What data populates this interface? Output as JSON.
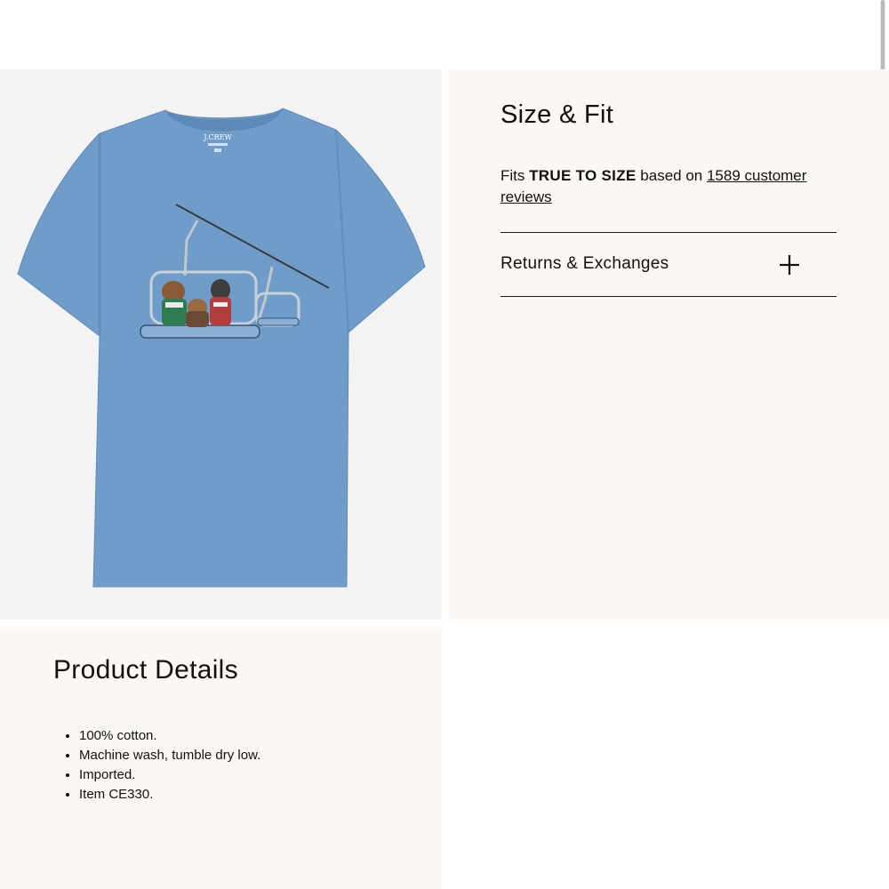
{
  "product_image": {
    "label_brand": "J.CREW",
    "color": "#6f9cc8"
  },
  "size_fit": {
    "title": "Size & Fit",
    "fit_prefix": "Fits",
    "fit_value": "TRUE TO SIZE",
    "fit_middle": "based on",
    "review_link": "1589 customer reviews"
  },
  "returns": {
    "label": "Returns & Exchanges",
    "icon": "plus-icon"
  },
  "product_details": {
    "title": "Product Details",
    "items": [
      "100% cotton.",
      "Machine wash, tumble dry low.",
      "Imported.",
      "Item CE330."
    ]
  },
  "colors": {
    "panel_bg": "#fbf7f3",
    "image_bg": "#f3f3f3",
    "shirt": "#6f9cc8"
  }
}
